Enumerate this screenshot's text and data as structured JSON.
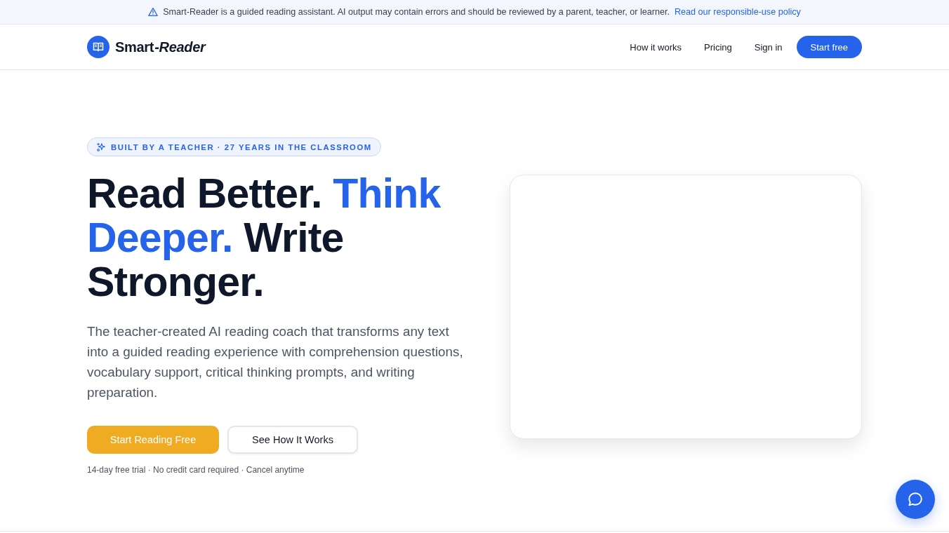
{
  "banner": {
    "message": "Smart-Reader is a guided reading assistant. AI output may contain errors and should be reviewed by a parent, teacher, or learner.",
    "link": "Read our responsible-use policy"
  },
  "nav": {
    "logo": [
      {
        "text": "Smart",
        "italic": false
      },
      {
        "text": "-Reader",
        "italic": true
      }
    ],
    "links": [
      "How it works",
      "Pricing",
      "Sign in"
    ],
    "cta": "Start free"
  },
  "hero": {
    "badge": "BUILT BY A TEACHER · 27 YEARS IN THE CLASSROOM",
    "headline": [
      {
        "text": "Read Better. ",
        "accent": false
      },
      {
        "text": "Think Deeper.",
        "accent": true
      },
      {
        "text": " Write Stronger.",
        "accent": false
      }
    ],
    "description": "The teacher-created AI reading coach that transforms any text into a guided reading experience with comprehension questions, vocabulary support, critical thinking prompts, and writing preparation.",
    "buttons": [
      {
        "label": "Start Reading Free",
        "kind": "primary"
      },
      {
        "label": "See How It Works",
        "kind": "secondary"
      }
    ],
    "note": "14-day free trial · No credit card required · Cancel anytime"
  }
}
